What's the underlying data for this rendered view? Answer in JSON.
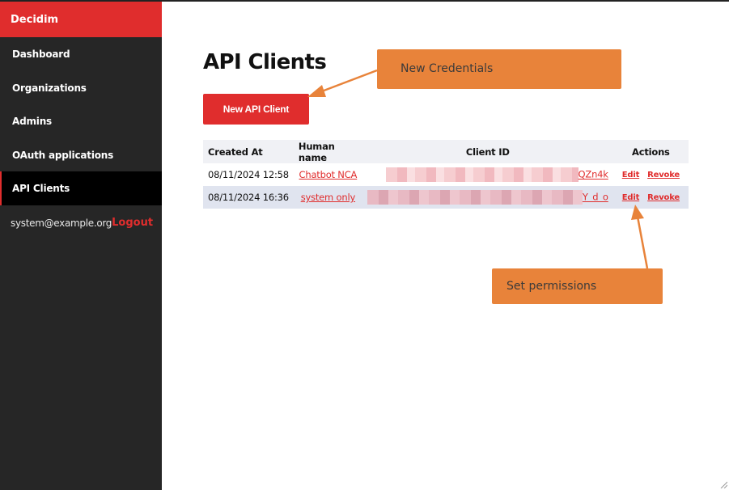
{
  "sidebar": {
    "brand": "Decidim",
    "items": [
      {
        "label": "Dashboard",
        "active": false
      },
      {
        "label": "Organizations",
        "active": false
      },
      {
        "label": "Admins",
        "active": false
      },
      {
        "label": "OAuth applications",
        "active": false
      },
      {
        "label": "API Clients",
        "active": true
      }
    ],
    "user_email": "system@example.org",
    "logout_label": "Logout"
  },
  "main": {
    "title": "API Clients",
    "new_button_label": "New API Client",
    "table": {
      "headers": [
        "Created At",
        "Human name",
        "Client ID",
        "Actions"
      ],
      "rows": [
        {
          "created_at": "08/11/2024 12:58",
          "human_name": "Chatbot NCA",
          "client_id_suffix": "QZn4k",
          "edit": "Edit",
          "revoke": "Revoke"
        },
        {
          "created_at": "08/11/2024 16:36",
          "human_name": "system only",
          "client_id_suffix": "Y_d_o",
          "edit": "Edit",
          "revoke": "Revoke"
        }
      ]
    }
  },
  "annotations": {
    "new_credentials": "New Credentials",
    "set_permissions": "Set permissions",
    "color": "#e8833a"
  },
  "colors": {
    "brand": "#e02d2d",
    "sidebar_bg": "#262626",
    "active_bg": "#000000"
  }
}
